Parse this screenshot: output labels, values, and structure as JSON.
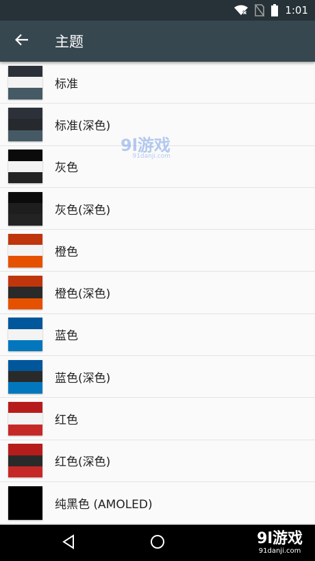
{
  "status_bar": {
    "time": "1:01"
  },
  "app_bar": {
    "title": "主题"
  },
  "themes": [
    {
      "label": "标准",
      "colors": [
        "#2c3139",
        "#f3f3f3",
        "#455a64"
      ]
    },
    {
      "label": "标准(深色)",
      "colors": [
        "#2c3139",
        "#26292d",
        "#455a64"
      ]
    },
    {
      "label": "灰色",
      "colors": [
        "#0b0b0b",
        "#f3f3f3",
        "#232323"
      ]
    },
    {
      "label": "灰色(深色)",
      "colors": [
        "#0b0b0b",
        "#1e1e1e",
        "#232323"
      ]
    },
    {
      "label": "橙色",
      "colors": [
        "#bf360c",
        "#f3f3f3",
        "#e65100"
      ]
    },
    {
      "label": "橙色(深色)",
      "colors": [
        "#bf360c",
        "#2a2a2a",
        "#e65100"
      ]
    },
    {
      "label": "蓝色",
      "colors": [
        "#01579b",
        "#f3f3f3",
        "#0277bd"
      ]
    },
    {
      "label": "蓝色(深色)",
      "colors": [
        "#01579b",
        "#2a2a2a",
        "#0277bd"
      ]
    },
    {
      "label": "红色",
      "colors": [
        "#b71c1c",
        "#f3f3f3",
        "#c62828"
      ]
    },
    {
      "label": "红色(深色)",
      "colors": [
        "#b71c1c",
        "#2a2a2a",
        "#c62828"
      ]
    },
    {
      "label": "纯黑色 (AMOLED)",
      "colors": [
        "#000000",
        "#000000",
        "#000000"
      ]
    }
  ],
  "watermark": {
    "main": "9l游戏",
    "sub": "91danji.com"
  },
  "colors": {
    "status_bar": "#263238",
    "app_bar": "#37474f",
    "background": "#fafafa"
  }
}
